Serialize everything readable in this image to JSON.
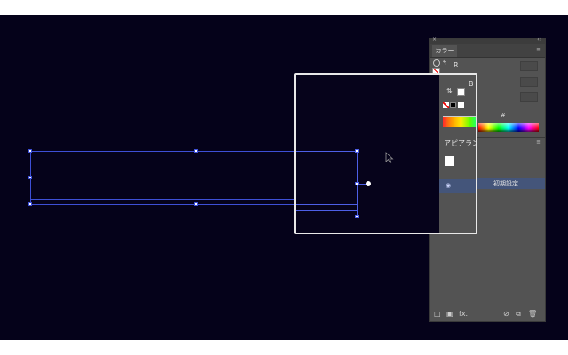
{
  "color_panel": {
    "tab_label": "カラー",
    "close_glyph": "×",
    "collapse_glyph": "‹‹",
    "menu_glyph": "≡",
    "channel_r": "R",
    "channel_g": "G",
    "channel_b": "B",
    "hex_prefix": "#",
    "fill_color": "#ffffff"
  },
  "appearance_panel": {
    "title": "アピアラン",
    "selected_row_label": "初期設定",
    "footer_fx": "fx."
  },
  "colors": {
    "canvas_bg": "#05021a",
    "selection_blue": "#3d4fd6",
    "panel_bg": "#535353",
    "selected_row": "#44557a"
  },
  "icons": [
    "swap-icon",
    "fill-swatch-icon",
    "none-swatch-icon",
    "cursor-arrow-icon",
    "menu-icon",
    "close-icon",
    "eye-icon",
    "new-layer-icon",
    "delete-icon",
    "fx-icon"
  ]
}
